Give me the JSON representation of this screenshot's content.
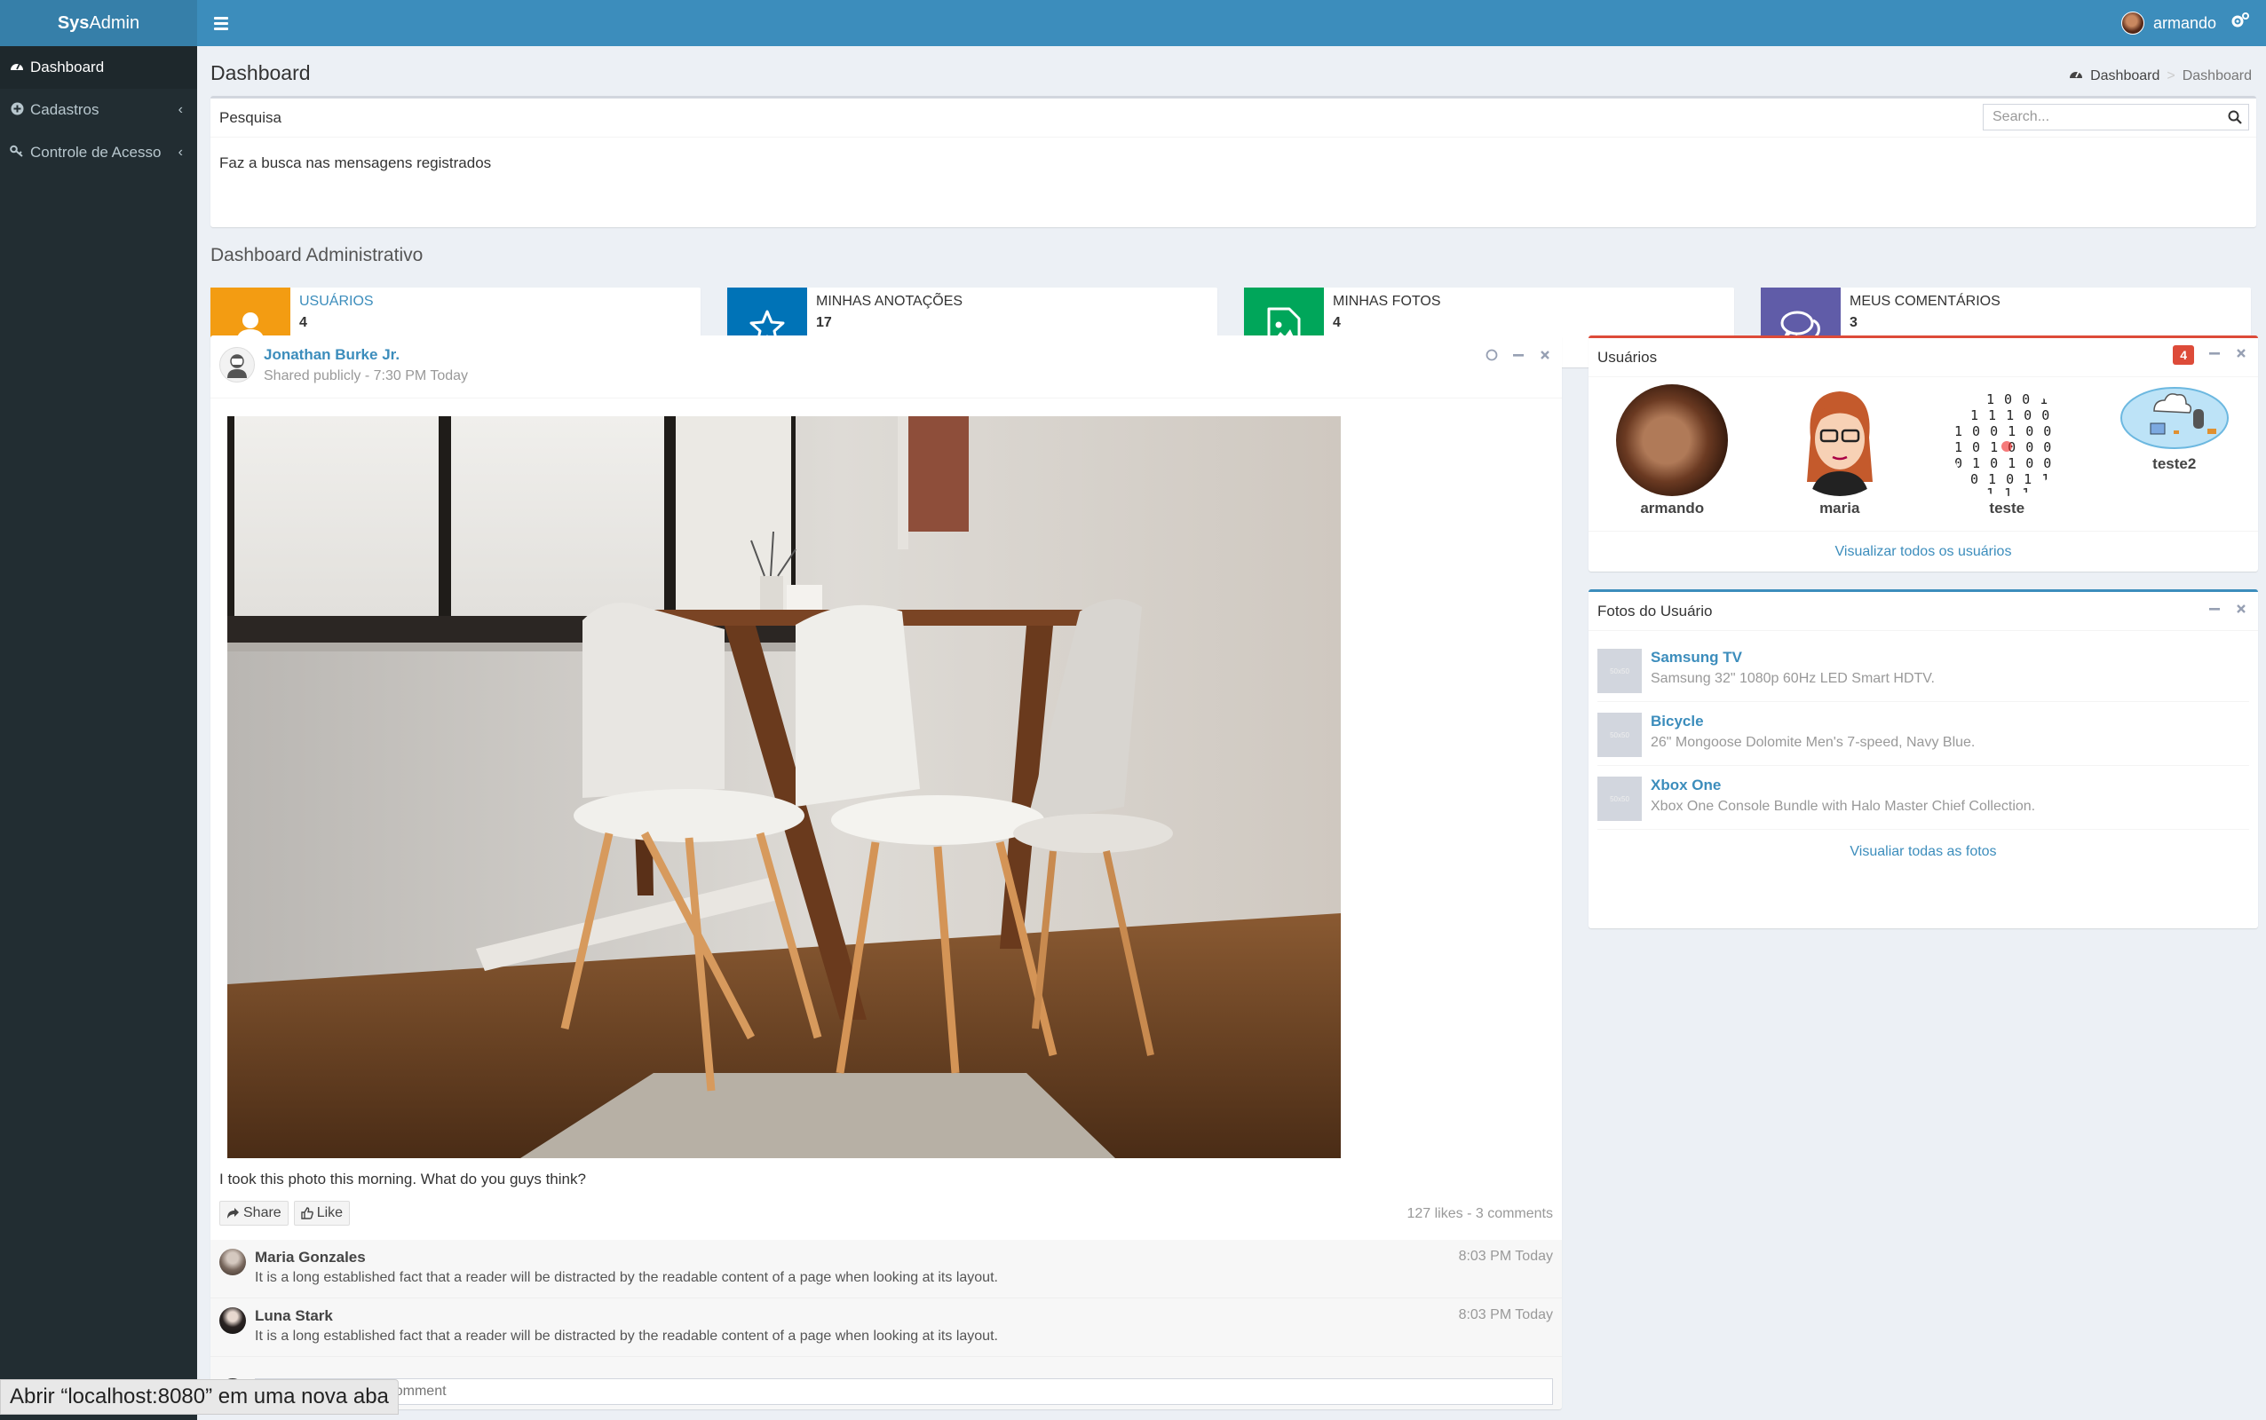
{
  "app": {
    "brand_bold": "Sys",
    "brand_rest": "Admin",
    "user_name": "armando"
  },
  "sidebar": {
    "items": [
      {
        "label": "Dashboard",
        "icon": "dashboard-icon",
        "active": true
      },
      {
        "label": "Cadastros",
        "icon": "plus-circle-icon"
      },
      {
        "label": "Controle de Acesso",
        "icon": "key-icon"
      }
    ]
  },
  "page": {
    "title": "Dashboard",
    "breadcrumb": [
      "Dashboard",
      "Dashboard"
    ]
  },
  "search": {
    "title": "Pesquisa",
    "placeholder": "Search...",
    "description": "Faz a busca nas mensagens registrados"
  },
  "section_title": "Dashboard Administrativo",
  "stats": [
    {
      "label": "USUÁRIOS",
      "value": "4",
      "color": "#f39c12"
    },
    {
      "label": "MINHAS ANOTAÇÕES",
      "value": "17",
      "color": "#0073b7"
    },
    {
      "label": "MINHAS FOTOS",
      "value": "4",
      "color": "#00a65a"
    },
    {
      "label": "MEUS COMENTÁRIOS",
      "value": "3",
      "color": "#605ca8"
    }
  ],
  "post": {
    "author": "Jonathan Burke Jr.",
    "meta": "Shared publicly - 7:30 PM Today",
    "text": "I took this photo this morning. What do you guys think?",
    "share_label": "Share",
    "like_label": "Like",
    "stats": "127 likes - 3 comments",
    "comments": [
      {
        "name": "Maria Gonzales",
        "time": "8:03 PM Today",
        "text": "It is a long established fact that a reader will be distracted by the readable content of a page when looking at its layout."
      },
      {
        "name": "Luna Stark",
        "time": "8:03 PM Today",
        "text": "It is a long established fact that a reader will be distracted by the readable content of a page when looking at its layout."
      }
    ],
    "comment_placeholder": "Press enter to post comment"
  },
  "users_box": {
    "title": "Usuários",
    "badge": "4",
    "users": [
      "armando",
      "maria",
      "teste",
      "teste2"
    ],
    "footer": "Visualizar todos os usuários"
  },
  "photos_box": {
    "title": "Fotos do Usuário",
    "items": [
      {
        "title": "Samsung TV",
        "desc": "Samsung 32\" 1080p 60Hz LED Smart HDTV."
      },
      {
        "title": "Bicycle",
        "desc": "26\" Mongoose Dolomite Men's 7-speed, Navy Blue."
      },
      {
        "title": "Xbox One",
        "desc": "Xbox One Console Bundle with Halo Master Chief Collection."
      }
    ],
    "footer": "Visualiar todas as fotos"
  },
  "status_bar": "Abrir “localhost:8080” em uma nova aba"
}
